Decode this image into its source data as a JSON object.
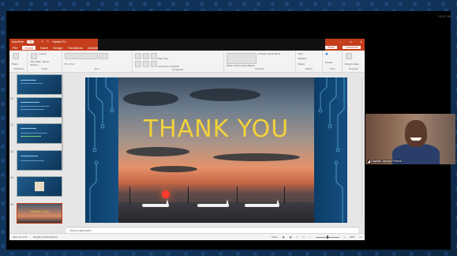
{
  "window": {
    "autosave_label": "AutoSave",
    "autosave_state": "On",
    "file_title": "Captain Pe...",
    "search_hint": ""
  },
  "clock": "01:07:46",
  "ribbon": {
    "tabs": [
      "File",
      "Home",
      "Insert",
      "Design",
      "Transitions",
      "Animatio..."
    ],
    "active_tab": "Home",
    "share_label": "Share",
    "comments_label": "Comments",
    "groups": [
      "Clipboard",
      "Slides",
      "Font",
      "Paragraph",
      "Drawing",
      "Editing",
      "Voice",
      "Designer"
    ],
    "buttons": {
      "paste": "Paste",
      "new_slide": "New Slide",
      "layout": "Layout",
      "reset": "Reset",
      "section": "Section",
      "align_text": "Align Text",
      "convert_smartart": "Convert to SmartArt",
      "arrange": "Arrange",
      "quick_styles": "Quick Styles",
      "shape_outline": "Shape Outline",
      "shape_effects": "Shape Effects",
      "find": "Find",
      "replace": "Replace",
      "select": "Select",
      "dictate": "Dictate",
      "design_ideas": "Design Ideas"
    }
  },
  "thumbnails": [
    {
      "num": "",
      "active": false
    },
    {
      "num": "10",
      "active": false
    },
    {
      "num": "11",
      "active": false
    },
    {
      "num": "12",
      "active": false
    },
    {
      "num": "13",
      "active": false
    },
    {
      "num": "14",
      "active": true
    }
  ],
  "slide": {
    "title": "THANK YOU"
  },
  "notes_placeholder": "Click to add notes",
  "status": {
    "slide_counter": "Slide 14 of 14",
    "language": "English (United States)",
    "notes": "Notes",
    "zoom": "56%"
  },
  "video": {
    "participant_name": "Captain Janaka Perera"
  },
  "colors": {
    "ppt_accent": "#c43e1c",
    "slide_title": "#f3d23a",
    "desktop_bg": "#0e2a4a"
  }
}
